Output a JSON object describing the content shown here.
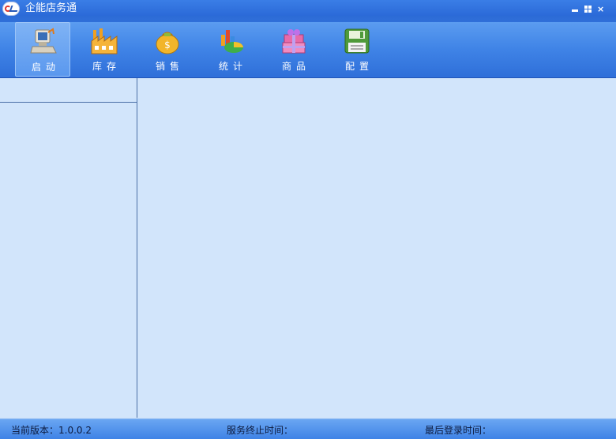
{
  "window": {
    "title": "企能店务通"
  },
  "toolbar": {
    "items": [
      {
        "label": "启动",
        "icon": "computer-icon"
      },
      {
        "label": "库存",
        "icon": "factory-icon"
      },
      {
        "label": "销售",
        "icon": "money-bag-icon"
      },
      {
        "label": "统计",
        "icon": "pie-chart-icon"
      },
      {
        "label": "商品",
        "icon": "gift-box-icon"
      },
      {
        "label": "配置",
        "icon": "floppy-disk-icon"
      }
    ]
  },
  "status": {
    "version": "当前版本：1.0.0.2",
    "service_end": "服务终止时间：",
    "last_login": "最后登录时间："
  },
  "colors": {
    "accent": "#3f83e6",
    "panel": "#d2e5fb"
  }
}
